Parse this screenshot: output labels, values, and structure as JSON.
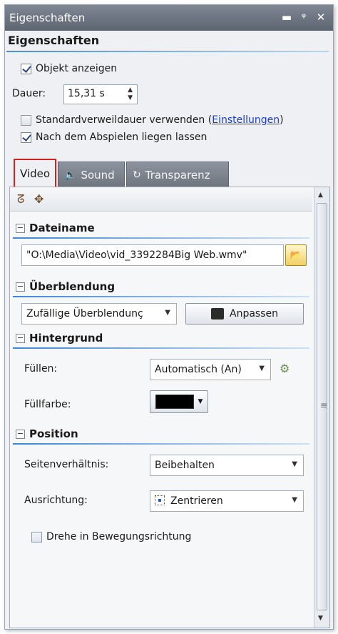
{
  "window": {
    "title": "Eigenschaften",
    "controls": {
      "minimize": "▬",
      "pin": "ᵠ",
      "close": "✕"
    }
  },
  "header": {
    "title": "Eigenschaften"
  },
  "general": {
    "show_object": {
      "label": "Objekt anzeigen",
      "checked": true
    },
    "duration": {
      "label": "Dauer:",
      "value": "15,31 s"
    },
    "default_duration": {
      "label": "Standardverweildauer verwenden (",
      "link": "Einstellungen",
      "suffix": ")",
      "checked": false
    },
    "keep_after_play": {
      "label": "Nach dem Abspielen liegen lassen",
      "checked": true
    }
  },
  "tabs": [
    {
      "label": "Video",
      "icon": "video-icon",
      "active": true
    },
    {
      "label": "Sound",
      "icon": "speaker-icon",
      "active": false
    },
    {
      "label": "Transparenz",
      "icon": "transparency-icon",
      "active": false
    }
  ],
  "sections": {
    "dateiname": {
      "title": "Dateiname",
      "file_value": "\"O:\\Media\\Video\\vid_3392284Big Web.wmv\""
    },
    "ueberblendung": {
      "title": "Überblendung",
      "select_value": "Zufällige Überblendunç",
      "button_label": "Anpassen"
    },
    "hintergrund": {
      "title": "Hintergrund",
      "fill_label": "Füllen:",
      "fill_value": "Automatisch (An)",
      "color_label": "Füllfarbe:",
      "color": "#000000"
    },
    "position": {
      "title": "Position",
      "aspect_label": "Seitenverhältnis:",
      "aspect_value": "Beibehalten",
      "align_label": "Ausrichtung:",
      "align_value": "Zentrieren",
      "rotate": {
        "label": "Drehe in Bewegungsrichtung",
        "checked": false
      }
    }
  },
  "colors": {
    "accent_line": "#3b87d9",
    "title_bar": "#6b737d",
    "active_tab_outline": "#d32020",
    "link": "#1a3ed6"
  }
}
